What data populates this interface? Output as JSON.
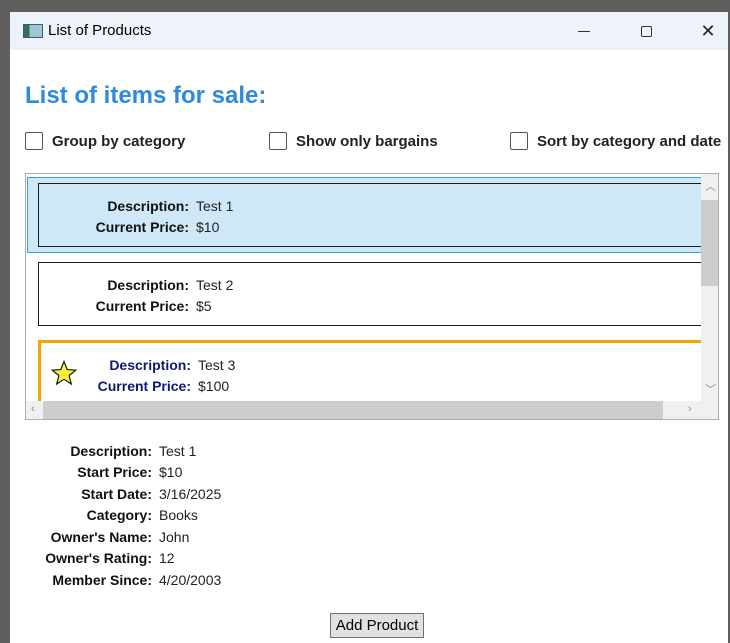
{
  "window": {
    "title": "List of Products",
    "minimize": "—",
    "maximize": "",
    "close": "✕"
  },
  "heading": "List of items for sale:",
  "options": [
    {
      "label": "Group by category",
      "checked": false
    },
    {
      "label": "Show only bargains",
      "checked": false
    },
    {
      "label": "Sort by category and date",
      "checked": false
    }
  ],
  "list": {
    "items": [
      {
        "description_label": "Description:",
        "description": "Test 1",
        "price_label": "Current Price:",
        "price": "$10",
        "selected": true,
        "featured": false
      },
      {
        "description_label": "Description:",
        "description": "Test 2",
        "price_label": "Current Price:",
        "price": "$5",
        "selected": false,
        "featured": false
      },
      {
        "description_label": "Description:",
        "description": "Test 3",
        "price_label": "Current Price:",
        "price": "$100",
        "selected": false,
        "featured": true
      }
    ]
  },
  "details": [
    {
      "label": "Description:",
      "value": "Test 1"
    },
    {
      "label": "Start Price:",
      "value": "$10"
    },
    {
      "label": "Start Date:",
      "value": "3/16/2025"
    },
    {
      "label": "Category:",
      "value": "Books"
    },
    {
      "label": "Owner's Name:",
      "value": "John"
    },
    {
      "label": "Owner's Rating:",
      "value": "12"
    },
    {
      "label": "Member Since:",
      "value": "4/20/2003"
    }
  ],
  "add_button": "Add Product",
  "colors": {
    "heading": "#2f8bd9",
    "selection": "#cfe8f7",
    "featured_border": "#f5a400",
    "star_fill": "#fff23a"
  }
}
